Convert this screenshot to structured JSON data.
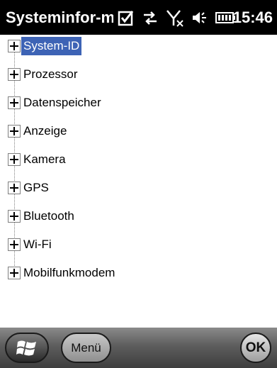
{
  "statusbar": {
    "title": "Systeminfor-matio",
    "time": "15:46",
    "icons": [
      "task-check-icon",
      "data-sync-icon",
      "signal-off-icon",
      "volume-icon",
      "battery-icon"
    ]
  },
  "tree": {
    "items": [
      {
        "label": "System-ID",
        "selected": true
      },
      {
        "label": "Prozessor"
      },
      {
        "label": "Datenspeicher"
      },
      {
        "label": "Anzeige"
      },
      {
        "label": "Kamera"
      },
      {
        "label": "GPS"
      },
      {
        "label": "Bluetooth"
      },
      {
        "label": "Wi-Fi"
      },
      {
        "label": "Mobilfunkmodem"
      }
    ]
  },
  "softkeys": {
    "start_icon": "windows-logo-icon",
    "menu_label": "Menü",
    "ok_label": "OK"
  },
  "colors": {
    "selection": "#3d63b5",
    "titlebar": "#000000"
  }
}
